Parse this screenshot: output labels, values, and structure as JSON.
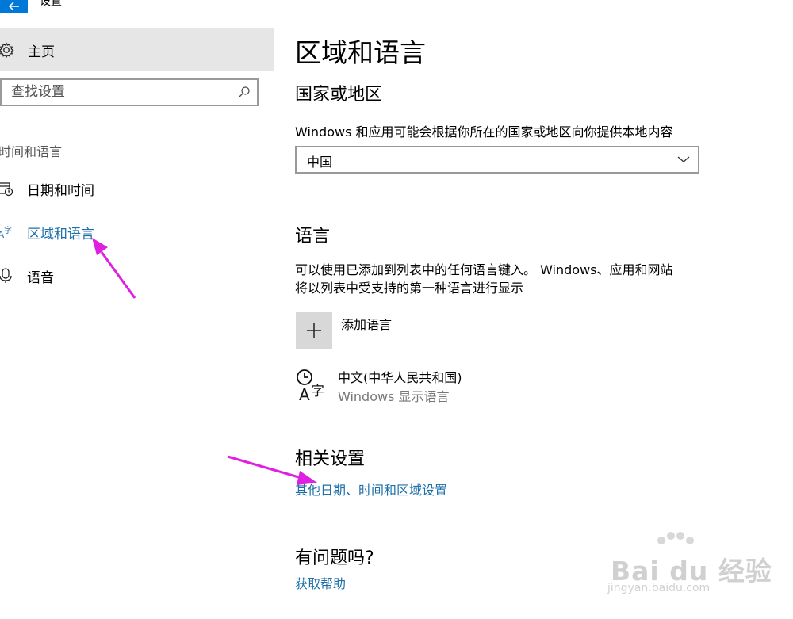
{
  "app": {
    "title": "设置"
  },
  "sidebar": {
    "home_label": "主页",
    "search_placeholder": "查找设置",
    "section_label": "时间和语言",
    "items": [
      {
        "label": "日期和时间",
        "icon": "calendar-clock-icon"
      },
      {
        "label": "区域和语言",
        "icon": "language-icon",
        "selected": true
      },
      {
        "label": "语音",
        "icon": "microphone-icon"
      }
    ]
  },
  "main": {
    "title": "区域和语言",
    "country": {
      "heading": "国家或地区",
      "description": "Windows 和应用可能会根据你所在的国家或地区向你提供本地内容",
      "selected": "中国"
    },
    "language": {
      "heading": "语言",
      "description_line1": "可以使用已添加到列表中的任何语言键入。 Windows、应用和网站",
      "description_line2": "将以列表中受支持的第一种语言进行显示",
      "add_label": "添加语言",
      "items": [
        {
          "name": "中文(中华人民共和国)",
          "sub": "Windows 显示语言"
        }
      ]
    },
    "related": {
      "heading": "相关设置",
      "link": "其他日期、时间和区域设置"
    },
    "help": {
      "heading": "有问题吗?",
      "link": "获取帮助"
    }
  },
  "watermark": {
    "brand": "Bai du 经验",
    "url": "jingyan.baidu.com"
  },
  "colors": {
    "accent": "#0078d7",
    "link": "#1c6fa8",
    "annotation": "#e020e0"
  }
}
